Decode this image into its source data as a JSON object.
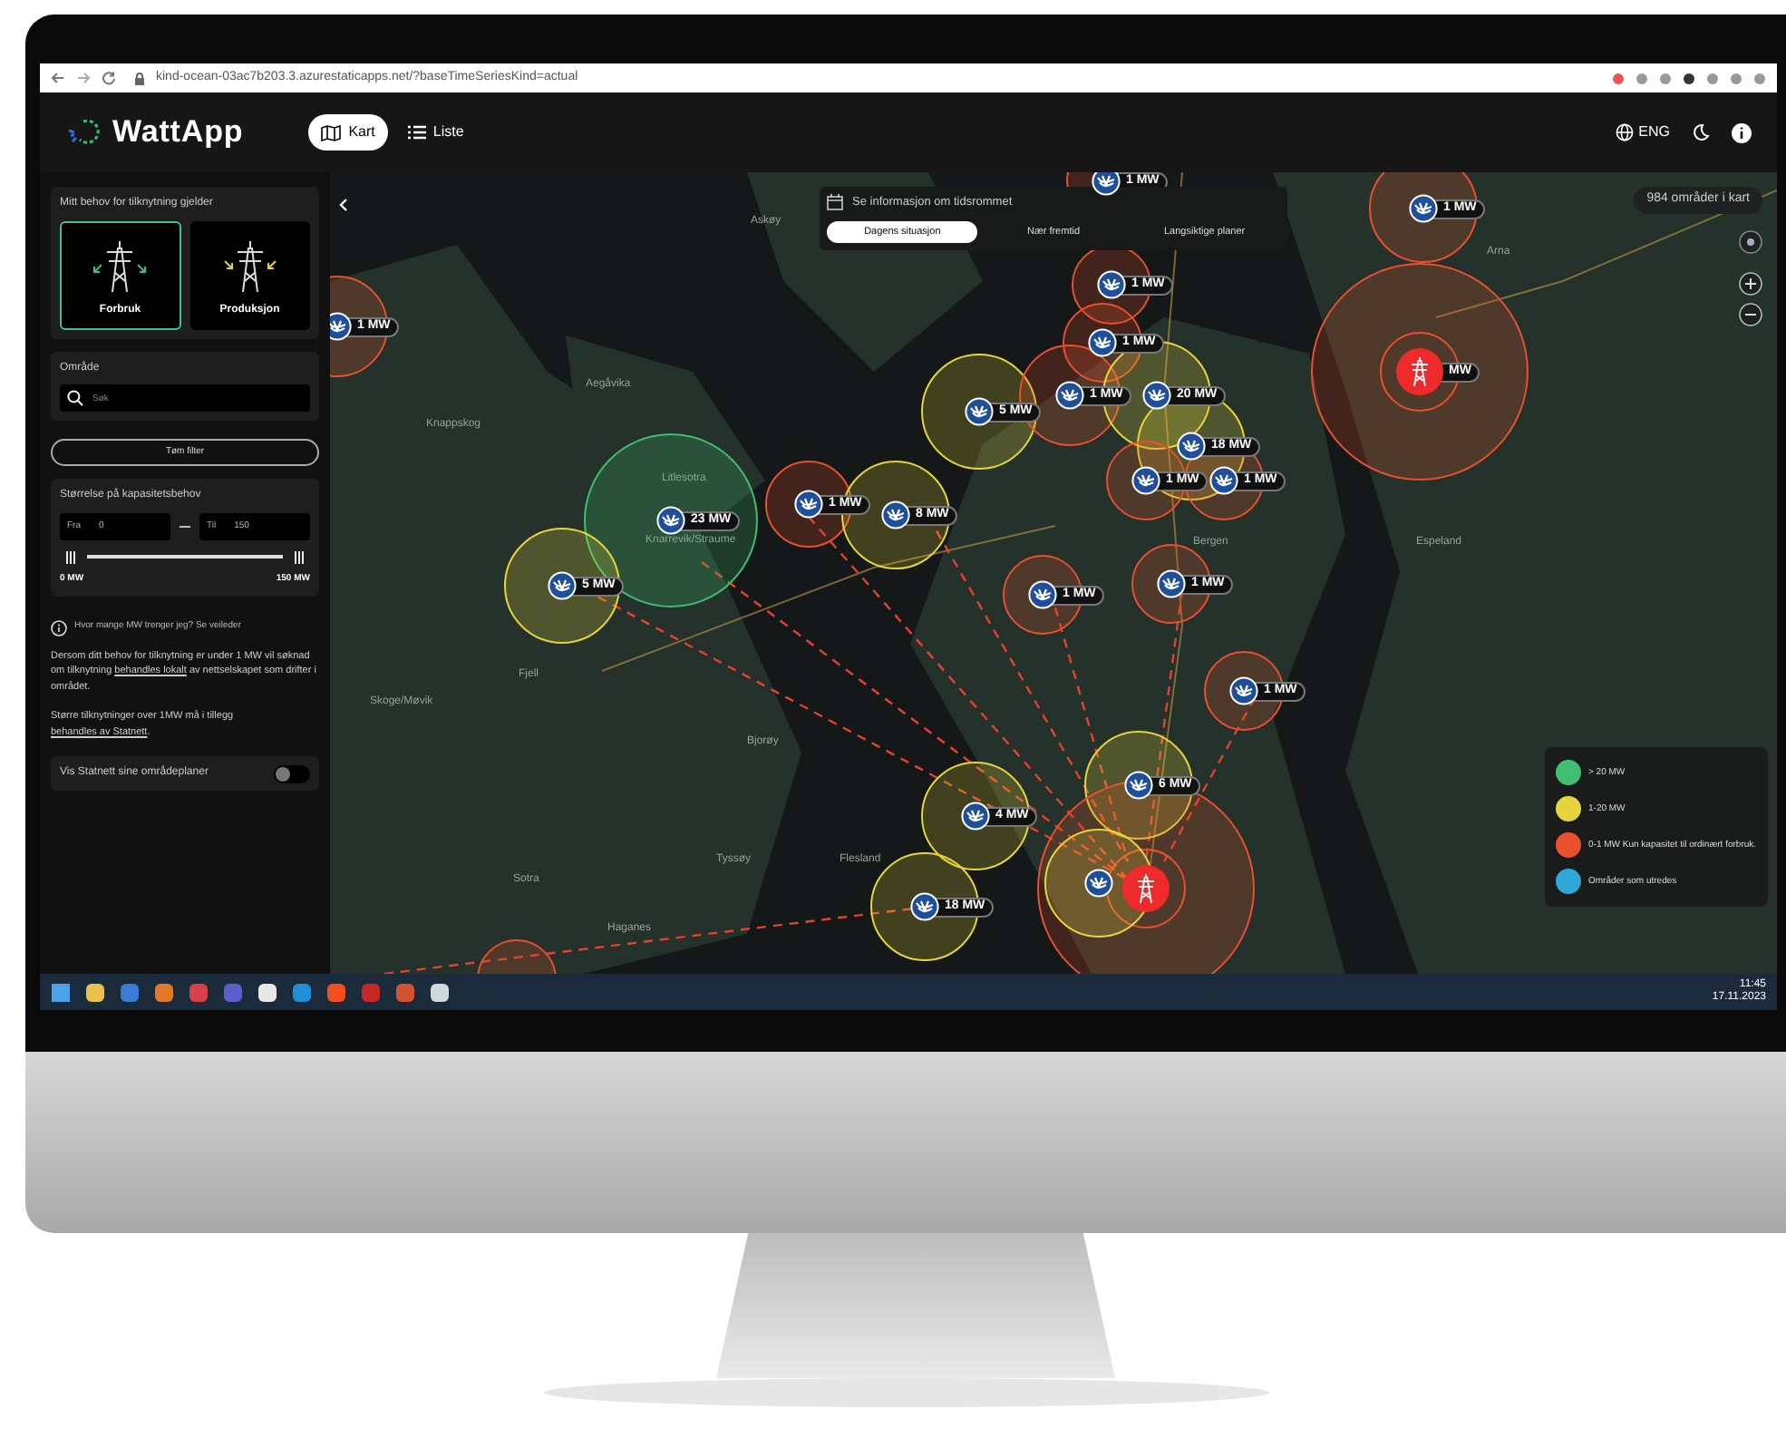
{
  "browser": {
    "url": "kind-ocean-03ac7b203.3.azurestaticapps.net/?baseTimeSeriesKind=actual"
  },
  "header": {
    "logo": "WattApp",
    "tabs": [
      {
        "label": "Kart",
        "selected": true
      },
      {
        "label": "Liste",
        "selected": false
      }
    ],
    "language": "ENG"
  },
  "sidebar": {
    "need_title": "Mitt behov for tilknytning gjelder",
    "need_options": [
      {
        "label": "Forbruk",
        "selected": true
      },
      {
        "label": "Produksjon",
        "selected": false
      }
    ],
    "area_title": "Område",
    "search": {
      "placeholder": "Søk"
    },
    "clear_button": "Tøm filter",
    "size_title": "Størrelse på kapasitetsbehov",
    "from_label": "Fra",
    "from_value": "0",
    "to_label": "Til",
    "to_value": "150",
    "slider": {
      "level": 1
    },
    "min_label": "0 MW",
    "max_label": "150 MW",
    "help_text": "Hvor mange MW trenger jeg? Se veileder",
    "info_1": {
      "before": "Dersom ditt behov for tilknytning er under 1 MW vil søknad om tilknytning",
      "link": "behandles lokalt",
      "after": "av nettselskapet som drifter i området."
    },
    "info_2": {
      "before": "Større tilknytninger over 1MW må i tillegg",
      "link": "behandles av Statnett",
      "after": "."
    },
    "toggle": {
      "label": "Vis Statnett sine områdeplaner",
      "on": false
    }
  },
  "map": {
    "time_panel": {
      "title": "Se informasjon om tidsrommet",
      "tabs": [
        {
          "label": "Dagens situasjon",
          "selected": true
        },
        {
          "label": "Nær fremtid",
          "selected": false
        },
        {
          "label": "Langsiktige planer",
          "selected": false
        }
      ]
    },
    "area_count": "984 områder i kart",
    "places": [
      "Askøy",
      "Aegåvika",
      "Knappskog",
      "Litlesotra",
      "Knarrevik/Straume",
      "Fjell",
      "Skoge/Møvik",
      "Bjorøy",
      "Tyssøy",
      "Flesland",
      "Sotra",
      "Haganes",
      "Bergen",
      "Arna",
      "Espeland"
    ],
    "markers": [
      {
        "kind": "wind",
        "color": "#e8502e",
        "label": "1 MW"
      },
      {
        "kind": "wind",
        "color": "#e8502e",
        "label": "1 MW"
      },
      {
        "kind": "wind",
        "color": "#e8502e",
        "label": "1 MW"
      },
      {
        "kind": "grid",
        "color": "#e8502e",
        "label": "MW"
      },
      {
        "kind": "wind",
        "color": "#e8502e",
        "label": "1 MW"
      },
      {
        "kind": "wind",
        "color": "#e8502e",
        "label": "1 MW"
      },
      {
        "kind": "wind",
        "color": "#e6d43c",
        "label": "5 MW"
      },
      {
        "kind": "wind",
        "color": "#e8502e",
        "label": "1 MW"
      },
      {
        "kind": "wind",
        "color": "#e6d43c",
        "label": "20 MW"
      },
      {
        "kind": "wind",
        "color": "#e6d43c",
        "label": "18 MW"
      },
      {
        "kind": "wind",
        "color": "#e8502e",
        "label": "1 MW"
      },
      {
        "kind": "wind",
        "color": "#e8502e",
        "label": "1 MW"
      },
      {
        "kind": "wind",
        "color": "#3fbf6f",
        "label": "23 MW"
      },
      {
        "kind": "wind",
        "color": "#e8502e",
        "label": "1 MW"
      },
      {
        "kind": "wind",
        "color": "#e6d43c",
        "label": "8 MW"
      },
      {
        "kind": "wind",
        "color": "#e6d43c",
        "label": "5 MW"
      },
      {
        "kind": "wind",
        "color": "#e8502e",
        "label": "1 MW"
      },
      {
        "kind": "wind",
        "color": "#e8502e",
        "label": "1 MW"
      },
      {
        "kind": "wind",
        "color": "#e8502e",
        "label": "1 MW"
      },
      {
        "kind": "wind",
        "color": "#e6d43c",
        "label": "6 MW"
      },
      {
        "kind": "wind",
        "color": "#e6d43c",
        "label": "4 MW"
      },
      {
        "kind": "wind",
        "color": "#e6d43c",
        "label": "18 MW"
      },
      {
        "kind": "grid",
        "color": "#e8502e"
      },
      {
        "kind": "wind",
        "color": "#e6d43c"
      },
      {
        "kind": "ring",
        "color": "#e8502e"
      }
    ],
    "legend": [
      {
        "label": "> 20 MW",
        "color": "#3fbf6f"
      },
      {
        "label": "1-20 MW",
        "color": "#e6d43c"
      },
      {
        "label": "0-1 MW Kun kapasitet til ordinært forbruk.",
        "color": "#e8502e"
      },
      {
        "label": "Områder som utredes",
        "color": "#2fa8d8"
      }
    ]
  },
  "taskbar": {
    "time": "11:45",
    "date": "17.11.2023"
  }
}
